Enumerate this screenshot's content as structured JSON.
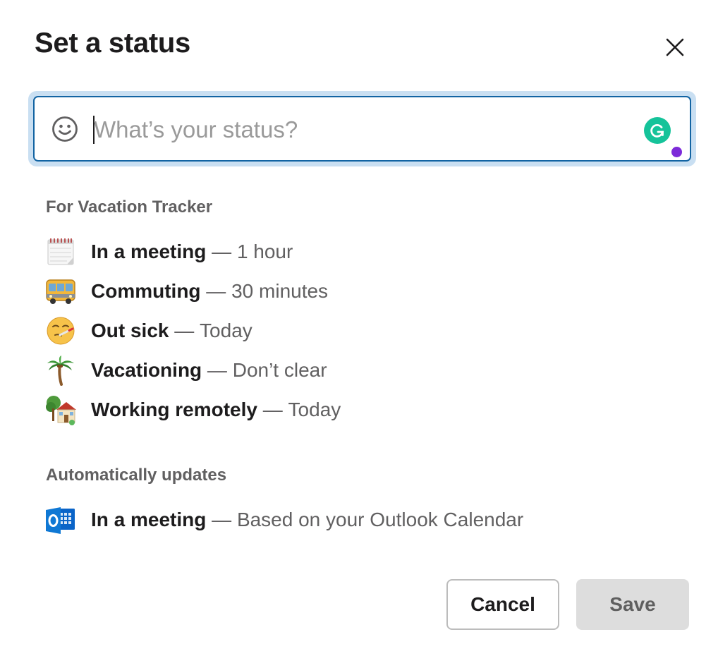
{
  "dialog": {
    "title": "Set a status"
  },
  "status_input": {
    "value": "",
    "placeholder": "What’s your status?"
  },
  "presets_section": {
    "label": "For Vacation Tracker",
    "items": [
      {
        "icon": "calendar-icon",
        "name": "In a meeting",
        "separator": " — ",
        "detail": "1 hour"
      },
      {
        "icon": "bus-icon",
        "name": "Commuting",
        "separator": " — ",
        "detail": "30 minutes"
      },
      {
        "icon": "sick-face-icon",
        "name": "Out sick",
        "separator": " — ",
        "detail": "Today"
      },
      {
        "icon": "palm-tree-icon",
        "name": "Vacationing",
        "separator": " — ",
        "detail": "Don’t clear"
      },
      {
        "icon": "house-with-garden-icon",
        "name": "Working remotely",
        "separator": " — ",
        "detail": "Today"
      }
    ]
  },
  "auto_section": {
    "label": "Automatically updates",
    "items": [
      {
        "icon": "outlook-icon",
        "name": "In a meeting",
        "separator": " — ",
        "detail": "Based on your Outlook Calendar"
      }
    ]
  },
  "footer": {
    "cancel_label": "Cancel",
    "save_label": "Save"
  },
  "colors": {
    "focus_border": "#1264a3",
    "focus_ring": "#c9dff2",
    "grammarly": "#15c39a",
    "grammarly_dot": "#7d2ad9",
    "save_disabled_bg": "#dddddd"
  }
}
